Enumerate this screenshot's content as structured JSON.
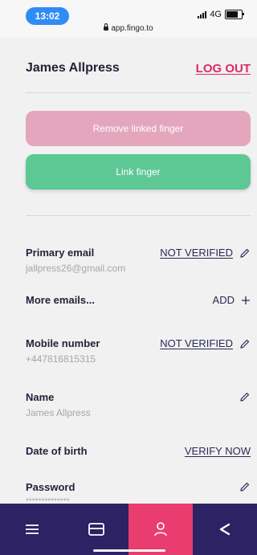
{
  "status_bar": {
    "time": "13:02",
    "network": "4G",
    "url": "app.fingo.to"
  },
  "header": {
    "user_name": "James Allpress",
    "logout_label": "LOG OUT"
  },
  "buttons": {
    "remove_label": "Remove linked finger",
    "link_label": "Link finger"
  },
  "fields": {
    "primary_email": {
      "label": "Primary email",
      "value": "jallpress26@gmail.com",
      "action": "NOT VERIFIED",
      "icon": "pencil-icon"
    },
    "more_emails": {
      "label": "More emails...",
      "action": "ADD",
      "icon": "plus-icon"
    },
    "mobile": {
      "label": "Mobile number",
      "value": "+447816815315",
      "action": "NOT VERIFIED",
      "icon": "pencil-icon"
    },
    "name": {
      "label": "Name",
      "value": "James Allpress",
      "icon": "pencil-icon"
    },
    "dob": {
      "label": "Date of birth",
      "action": "VERIFY NOW"
    },
    "password": {
      "label": "Password",
      "value": "**************",
      "icon": "pencil-icon"
    }
  },
  "bottom_nav": {
    "items": [
      "menu-icon",
      "card-icon",
      "profile-icon",
      "share-icon"
    ],
    "active": "profile-icon"
  },
  "colors": {
    "accent_pink": "#db2b63",
    "nav_bg": "#2d2264",
    "nav_active": "#e83d6e",
    "green_button": "#5dc894",
    "pink_button": "#e4a6bc"
  }
}
